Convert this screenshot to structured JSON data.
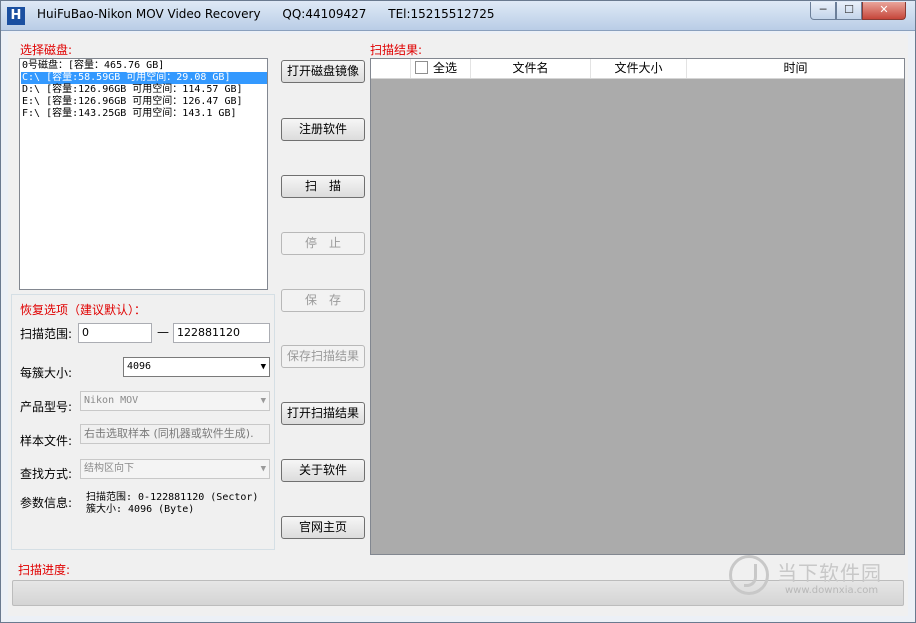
{
  "window": {
    "title_parts": [
      "HuiFuBao-Nikon MOV Video Recovery",
      "QQ:44109427",
      "TEl:15215512725"
    ],
    "minimize_glyph": "─",
    "maximize_glyph": "☐",
    "close_glyph": "✕",
    "app_icon_glyph": "H"
  },
  "disk_panel": {
    "label": "选择磁盘:",
    "items": [
      "0号磁盘：[容量：465.76 GB]",
      "C:\\ [容量:58.59GB 可用空间：29.08 GB]",
      "D:\\ [容量:126.96GB 可用空间：114.57 GB]",
      "E:\\ [容量:126.96GB 可用空间：126.47 GB]",
      "F:\\ [容量:143.25GB 可用空间：143.1 GB]"
    ],
    "selected_index": 1
  },
  "options": {
    "label": "恢复选项（建议默认）：",
    "scan_range_label": "扫描范围:",
    "scan_start": "0",
    "range_dash": "—",
    "scan_end": "122881120",
    "cluster_label": "每簇大小:",
    "cluster_value": "4096",
    "model_label": "产品型号:",
    "model_value": "Nikon MOV",
    "sample_label": "样本文件:",
    "sample_placeholder": "右击选取样本 (同机器或软件生成).",
    "search_label": "查找方式:",
    "search_value": "结构区向下",
    "param_label": "参数信息:",
    "param_line1": "扫描范围: 0-122881120 (Sector)",
    "param_line2": "簇大小: 4096 (Byte)"
  },
  "buttons": {
    "open_image": "打开磁盘镜像",
    "register": "注册软件",
    "scan": "扫　描",
    "stop": "停　止",
    "save": "保　存",
    "save_results": "保存扫描结果",
    "open_results": "打开扫描结果",
    "about": "关于软件",
    "homepage": "官网主页"
  },
  "results": {
    "label": "扫描结果:",
    "columns": {
      "select_all": "全选",
      "filename": "文件名",
      "filesize": "文件大小",
      "time": "时间"
    }
  },
  "progress": {
    "label": "扫描进度:",
    "value": 0
  },
  "watermark": {
    "text": "当下软件园",
    "url": "www.downxia.com"
  }
}
